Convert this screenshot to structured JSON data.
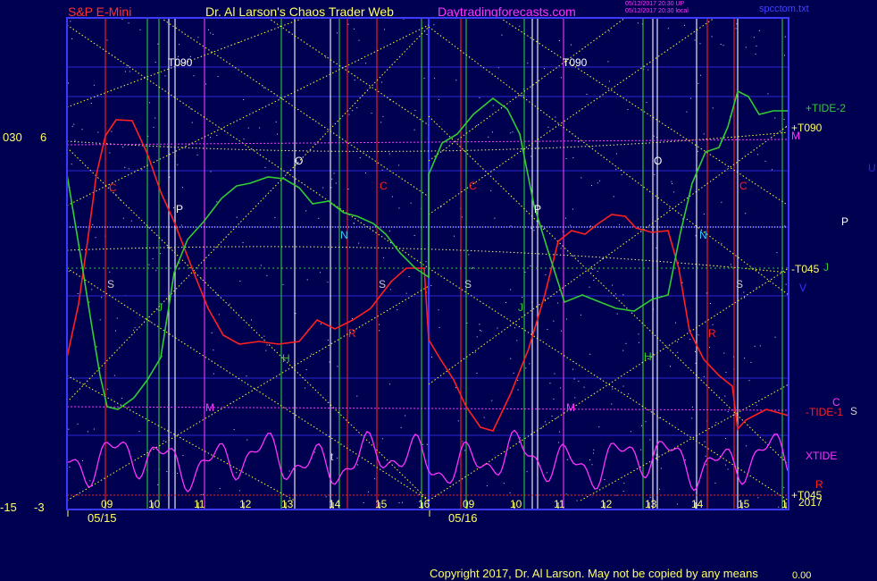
{
  "header": {
    "symbol": "S&P E-Mini",
    "author": "Dr. Al Larson's Chaos Trader Web",
    "site": "Daytradingforecasts.com",
    "stamp1": "05/12/2017 20:30 UP",
    "stamp2": "05/12/2017 20:30 local",
    "file": "spcctom.txt"
  },
  "left_axis": {
    "top_a": "030",
    "top_b": "6",
    "bottom_a": "-15",
    "bottom_b": "-3"
  },
  "dates": [
    "05/15",
    "05/16"
  ],
  "hours": [
    "09",
    "10",
    "11",
    "12",
    "13",
    "14",
    "15",
    "16",
    "09",
    "10",
    "11",
    "12",
    "13",
    "14",
    "15",
    "1"
  ],
  "right_labels": {
    "tide2": "+TIDE-2",
    "t090": "+T090",
    "m": "M",
    "u": "U",
    "p": "P",
    "t045": "-T045",
    "j": "J",
    "v": "V",
    "c": "C",
    "tide1": "-TIDE-1",
    "s": "S",
    "xtide": "XTIDE",
    "r": "R",
    "t045b": "+T045",
    "year": "2017"
  },
  "chart_labels": {
    "t090": "T090",
    "c": "C",
    "p": "P",
    "o": "O",
    "n": "N",
    "s": "S",
    "r": "R",
    "h": "H",
    "j": "J",
    "m": "M",
    "t": "t"
  },
  "copyright": "Copyright 2017, Dr. Al Larson. May not be copied by any means",
  "footer_value": "0.00",
  "colors": {
    "background": "#000050",
    "plot_border": "#3a3aff",
    "red_line": "#ff2020",
    "green_line": "#33cc33",
    "magenta_line": "#ff33ff",
    "yellow_dotted": "#ffff33",
    "white_line": "#ffffff"
  },
  "chart_data": {
    "type": "line",
    "title": "S&P E-Mini",
    "x": [
      "05/15 09",
      "05/15 10",
      "05/15 11",
      "05/15 12",
      "05/15 13",
      "05/15 14",
      "05/15 15",
      "05/15 16",
      "05/16 09",
      "05/16 10",
      "05/16 11",
      "05/16 12",
      "05/16 13",
      "05/16 14",
      "05/16 15",
      "05/16 16"
    ],
    "ylim_left": [
      -3,
      6
    ],
    "series": [
      {
        "name": "C",
        "color": "#ff2020"
      },
      {
        "name": "J",
        "color": "#33cc33"
      },
      {
        "name": "XTIDE",
        "color": "#ff33ff"
      }
    ],
    "vertical_markers": [
      "C",
      "J",
      "M",
      "P",
      "O",
      "H",
      "N",
      "S",
      "R",
      "t"
    ]
  }
}
